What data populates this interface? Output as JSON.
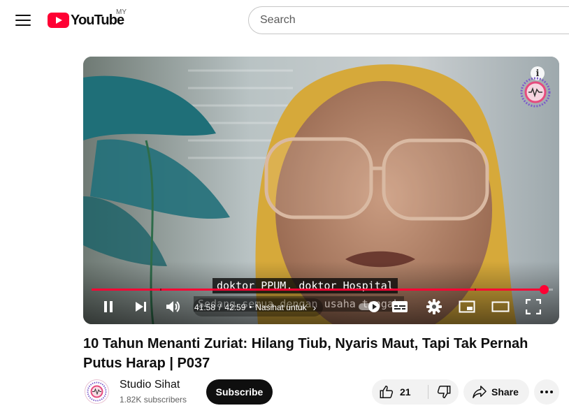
{
  "header": {
    "logo_text": "YouTube",
    "country_code": "MY",
    "search_placeholder": "Search"
  },
  "player": {
    "progress_fraction": 0.9808,
    "time_current": "41:58",
    "time_separator": "/",
    "time_total": "42:59",
    "chapter_separator": "•",
    "chapter_title": "Nasihat untuk",
    "chapter_chevron": "›",
    "captions": [
      "doktor PPUM, doktor Hospital",
      "Sedang semua dengan usaha tengah"
    ],
    "icons": {
      "info": "info-icon",
      "watermark": "channel-watermark-logo",
      "pause": "pause-icon",
      "next": "next-icon",
      "volume": "volume-icon",
      "autoplay": "autoplay-toggle-icon",
      "subtitles": "subtitles-icon",
      "settings": "gear-icon",
      "miniplayer": "miniplayer-icon",
      "theater": "theater-mode-icon",
      "fullscreen": "fullscreen-icon"
    },
    "accent_color": "#ff0033"
  },
  "video": {
    "title": "10 Tahun Menanti Zuriat: Hilang Tiub, Nyaris Maut, Tapi Tak Pernah Putus Harap | P037"
  },
  "channel": {
    "name": "Studio Sihat",
    "subscribers": "1.82K subscribers",
    "subscribe_label": "Subscribe"
  },
  "actions": {
    "like_count": "21",
    "share_label": "Share",
    "more_label": "•••"
  }
}
